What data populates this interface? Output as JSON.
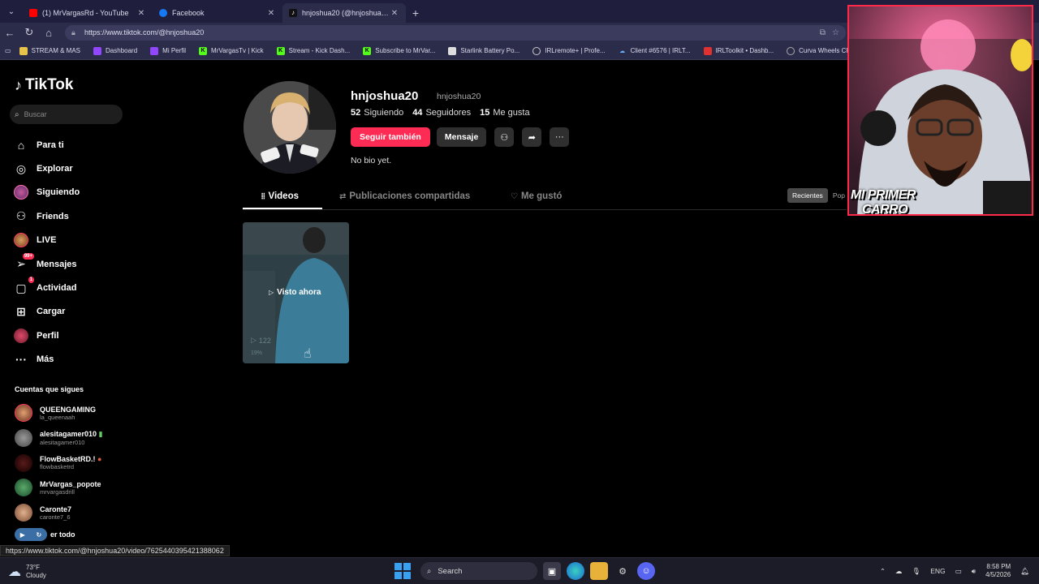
{
  "browser": {
    "tabs": [
      {
        "title": "(1) MrVargasRd - YouTube",
        "favicon_color": "#ff0000",
        "active": false
      },
      {
        "title": "Facebook",
        "favicon_color": "#1877f2",
        "active": false
      },
      {
        "title": "hnjoshua20 (@hnjoshua20) | TikTok",
        "favicon_color": "#111111",
        "active": true
      }
    ],
    "url": "https://www.tiktok.com/@hnjoshua20",
    "bookmarks": [
      {
        "label": "STREAM & MAS",
        "icon": "folder-icon",
        "color": "#e8c34a"
      },
      {
        "label": "Dashboard",
        "icon": "twitch-icon",
        "color": "#9146ff"
      },
      {
        "label": "Mi Perfil",
        "icon": "twitch-icon",
        "color": "#9146ff"
      },
      {
        "label": "MrVargasTv | Kick",
        "icon": "kick-icon",
        "color": "#53fc18"
      },
      {
        "label": "Stream - Kick Dash...",
        "icon": "kick-icon",
        "color": "#53fc18"
      },
      {
        "label": "Subscribe to MrVar...",
        "icon": "kick-icon",
        "color": "#53fc18"
      },
      {
        "label": "Starlink Battery Po...",
        "icon": "page-icon",
        "color": "#dddddd"
      },
      {
        "label": "IRLremote+ | Profe...",
        "icon": "globe-icon",
        "color": "#cccccc"
      },
      {
        "label": "Client #6576 | IRLT...",
        "icon": "cloud-icon",
        "color": "#6ab0ff"
      },
      {
        "label": "IRLToolkit • Dashb...",
        "icon": "irltoolkit-icon",
        "color": "#e03030"
      },
      {
        "label": "Curva Wheels CFF76",
        "icon": "wheel-icon",
        "color": "#aaaaaa"
      }
    ]
  },
  "tiktok": {
    "logo_text": "TikTok",
    "search_placeholder": "Buscar",
    "nav": [
      {
        "label": "Para ti",
        "icon": "home-icon"
      },
      {
        "label": "Explorar",
        "icon": "compass-icon"
      },
      {
        "label": "Siguiendo",
        "icon": "following-avatar-icon"
      },
      {
        "label": "Friends",
        "icon": "friends-icon"
      },
      {
        "label": "LIVE",
        "icon": "live-avatar-icon"
      },
      {
        "label": "Mensajes",
        "icon": "messages-icon",
        "badge": "99+"
      },
      {
        "label": "Actividad",
        "icon": "activity-icon",
        "badge": "1"
      },
      {
        "label": "Cargar",
        "icon": "upload-icon"
      },
      {
        "label": "Perfil",
        "icon": "profile-avatar-icon"
      },
      {
        "label": "Más",
        "icon": "more-icon"
      }
    ],
    "following_title": "Cuentas que sigues",
    "following": [
      {
        "name": "QUEENGAMING",
        "handle": "la_queenaah",
        "color": "#c0704a"
      },
      {
        "name": "alesitagamer010",
        "handle": "alesitagamer010",
        "color": "#777777"
      },
      {
        "name": "FlowBasketRD.!",
        "handle": "flowbasketrd",
        "color": "#2a1010"
      },
      {
        "name": "MrVargas_popote",
        "handle": "mrvargasdrill",
        "color": "#2e7a4a"
      },
      {
        "name": "Caronte7",
        "handle": "caronte7_6",
        "color": "#c08a6a"
      }
    ],
    "see_all": "er todo",
    "status_url": "https://www.tiktok.com/@hnjoshua20/video/7625440395421388062"
  },
  "profile": {
    "username": "hnjoshua20",
    "nickname": "hnjoshua20",
    "stats": [
      {
        "value": "52",
        "label": "Siguiendo"
      },
      {
        "value": "44",
        "label": "Seguidores"
      },
      {
        "value": "15",
        "label": "Me gusta"
      }
    ],
    "follow_back_label": "Seguir también",
    "message_label": "Mensaje",
    "bio": "No bio yet.",
    "tabs": [
      {
        "label": "Videos",
        "icon": "grid-icon"
      },
      {
        "label": "Publicaciones compartidas",
        "icon": "repost-icon"
      },
      {
        "label": "Me gustó",
        "icon": "heart-icon"
      }
    ],
    "sort_options": [
      "Recientes",
      "Pop"
    ],
    "video": {
      "overlay": "Visto ahora",
      "views": "122",
      "percent": "19%"
    }
  },
  "webcam": {
    "banner_line1": "MI PRIMER",
    "banner_line2": "CARRO"
  },
  "taskbar": {
    "temperature": "73°F",
    "condition": "Cloudy",
    "search_label": "Search",
    "language": "ENG",
    "time": "8:58 PM",
    "date": "4/5/2026"
  }
}
